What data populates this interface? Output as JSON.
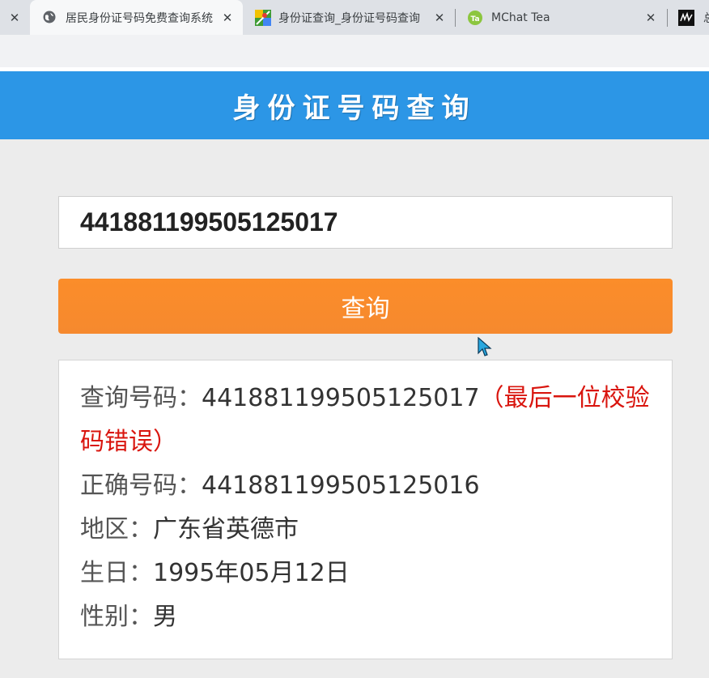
{
  "browser": {
    "tabs": [
      {
        "title": "居民身份证号码免费查询系统",
        "icon": "globe-icon",
        "active": true
      },
      {
        "title": "身份证查询_身份证号码查询",
        "icon": "map-icon",
        "active": false
      },
      {
        "title": "MChat Tea",
        "icon": "mchat-icon",
        "active": false
      },
      {
        "title": "总",
        "icon": "signature-icon",
        "active": false
      }
    ],
    "close_glyph": "✕"
  },
  "header": {
    "title": "身份证号码查询",
    "bg_color": "#2c96e6"
  },
  "search": {
    "value": "441881199505125017"
  },
  "query_button": {
    "label": "查询",
    "color": "#f98b2c"
  },
  "result": {
    "query_label": "查询号码：",
    "query_value": "441881199505125017",
    "query_error": "（最后一位校验码错误）",
    "correct_label": "正确号码：",
    "correct_value": "441881199505125016",
    "region_label": "地区：",
    "region_value": "广东省英德市",
    "birthday_label": "生日：",
    "birthday_value": "1995年05月12日",
    "gender_label": "性别：",
    "gender_value": "男",
    "error_color": "#d9150e"
  }
}
